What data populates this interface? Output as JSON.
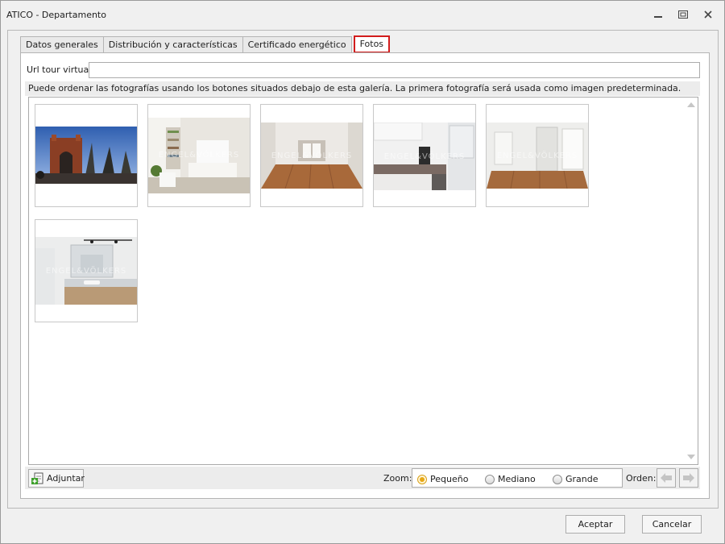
{
  "window": {
    "title": "ATICO - Departamento",
    "controls": [
      "minimize-icon",
      "restore-icon",
      "close-icon"
    ]
  },
  "tabs": [
    {
      "label": "Datos generales",
      "active": false
    },
    {
      "label": "Distribución y características",
      "active": false
    },
    {
      "label": "Certificado energético",
      "active": false
    },
    {
      "label": "Fotos",
      "active": true
    }
  ],
  "form": {
    "url_label": "Url tour virtual:",
    "url_value": "",
    "info_text": "Puede ordenar las fotografías usando los botones situados debajo de esta galería. La primera fotografía será usada como imagen predeterminada."
  },
  "gallery": {
    "photos": [
      {
        "name": "photo-arc-de-triomf",
        "watermark": ""
      },
      {
        "name": "photo-living-room",
        "watermark": "ENGEL&VÖLKERS"
      },
      {
        "name": "photo-empty-room",
        "watermark": "ENGEL&VÖLKERS"
      },
      {
        "name": "photo-kitchen",
        "watermark": "ENGEL&VÖLKERS"
      },
      {
        "name": "photo-bedroom",
        "watermark": "ENGEL&VÖLKERS"
      },
      {
        "name": "photo-bathroom",
        "watermark": "ENGEL&VÖLKERS"
      }
    ]
  },
  "toolbar": {
    "attach_label": "Adjuntar",
    "zoom_label": "Zoom:",
    "zoom_options": [
      {
        "label": "Pequeño",
        "checked": true
      },
      {
        "label": "Mediano",
        "checked": false
      },
      {
        "label": "Grande",
        "checked": false
      }
    ],
    "order_label": "Orden:"
  },
  "footer": {
    "accept_label": "Aceptar",
    "cancel_label": "Cancelar"
  },
  "colors": {
    "active_tab_border": "#d21d1d",
    "radio_selected": "#e7a817",
    "window_bg": "#f0f0f0"
  }
}
